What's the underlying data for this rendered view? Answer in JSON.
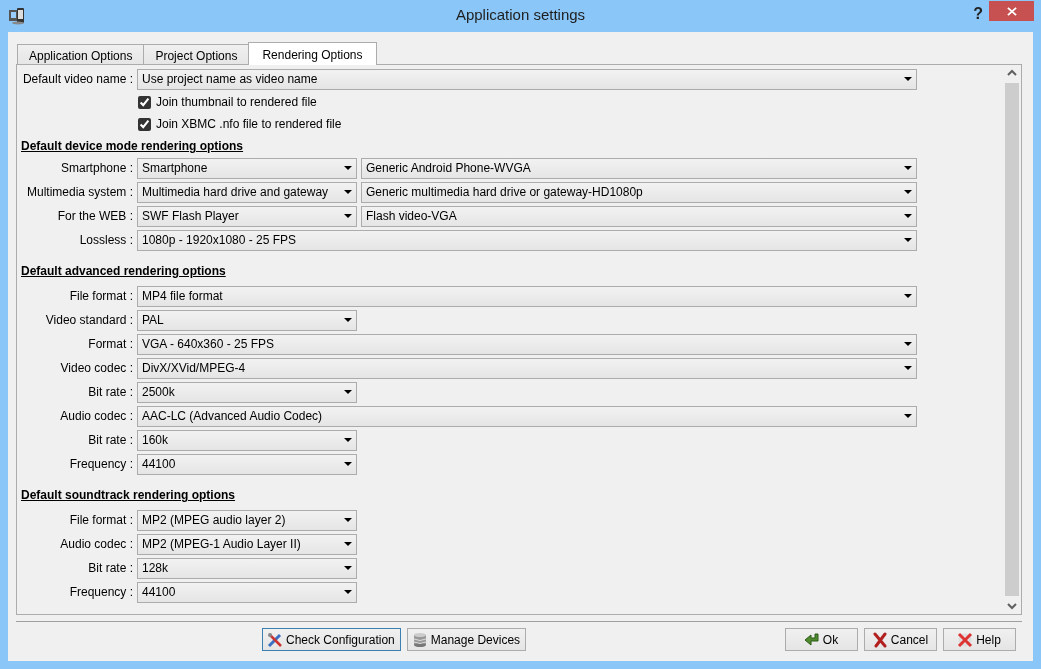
{
  "window": {
    "title": "Application settings",
    "help_button": "?"
  },
  "tabs": [
    {
      "label": "Application Options",
      "selected": false
    },
    {
      "label": "Project Options",
      "selected": false
    },
    {
      "label": "Rendering Options",
      "selected": true
    }
  ],
  "general": {
    "label": "Default video name :",
    "value": "Use project name as video name",
    "checkboxes": [
      {
        "label": "Join thumbnail to rendered file",
        "checked": true
      },
      {
        "label": "Join XBMC .nfo file to rendered file",
        "checked": true
      }
    ]
  },
  "sections": [
    {
      "title": "Default device mode rendering options",
      "rows": [
        {
          "label": "Smartphone :",
          "combos": [
            {
              "value": "Smartphone",
              "kind": "narrow"
            },
            {
              "value": "Generic Android Phone-WVGA",
              "kind": "wide"
            }
          ]
        },
        {
          "label": "Multimedia system :",
          "combos": [
            {
              "value": "Multimedia hard drive and gateway",
              "kind": "narrow"
            },
            {
              "value": "Generic multimedia hard drive or gateway-HD1080p",
              "kind": "wide"
            }
          ]
        },
        {
          "label": "For the WEB :",
          "combos": [
            {
              "value": "SWF Flash Player",
              "kind": "narrow"
            },
            {
              "value": "Flash video-VGA",
              "kind": "wide"
            }
          ]
        },
        {
          "label": "Lossless :",
          "combos": [
            {
              "value": "1080p - 1920x1080 - 25 FPS",
              "kind": "wide"
            }
          ]
        }
      ]
    },
    {
      "title": "Default advanced rendering options",
      "rows": [
        {
          "label": "File format :",
          "combos": [
            {
              "value": "MP4 file format",
              "kind": "wide"
            }
          ]
        },
        {
          "label": "Video standard :",
          "combos": [
            {
              "value": "PAL",
              "kind": "narrow"
            }
          ]
        },
        {
          "label": "Format :",
          "combos": [
            {
              "value": "VGA - 640x360 - 25 FPS",
              "kind": "wide"
            }
          ]
        },
        {
          "label": "Video codec :",
          "combos": [
            {
              "value": "DivX/XVid/MPEG-4",
              "kind": "wide"
            }
          ]
        },
        {
          "label": "Bit rate :",
          "combos": [
            {
              "value": "2500k",
              "kind": "narrow"
            }
          ]
        },
        {
          "label": "Audio codec :",
          "combos": [
            {
              "value": "AAC-LC (Advanced Audio Codec)",
              "kind": "wide"
            }
          ]
        },
        {
          "label": "Bit rate :",
          "combos": [
            {
              "value": "160k",
              "kind": "narrow"
            }
          ]
        },
        {
          "label": "Frequency :",
          "combos": [
            {
              "value": "44100",
              "kind": "narrow"
            }
          ]
        }
      ]
    },
    {
      "title": "Default soundtrack rendering options",
      "rows": [
        {
          "label": "File format :",
          "combos": [
            {
              "value": "MP2 (MPEG audio layer 2)",
              "kind": "narrow"
            }
          ]
        },
        {
          "label": "Audio codec :",
          "combos": [
            {
              "value": "MP2 (MPEG-1 Audio Layer II)",
              "kind": "narrow"
            }
          ]
        },
        {
          "label": "Bit rate :",
          "combos": [
            {
              "value": "128k",
              "kind": "narrow"
            }
          ]
        },
        {
          "label": "Frequency :",
          "combos": [
            {
              "value": "44100",
              "kind": "narrow"
            }
          ]
        }
      ]
    }
  ],
  "left_buttons": [
    {
      "label": "Check Configuration",
      "kind": "tools",
      "focused": true
    },
    {
      "label": "Manage Devices",
      "kind": "database",
      "focused": false
    }
  ],
  "right_buttons": [
    {
      "label": "Ok",
      "kind": "ok"
    },
    {
      "label": "Cancel",
      "kind": "cancel"
    },
    {
      "label": "Help",
      "kind": "help"
    }
  ]
}
